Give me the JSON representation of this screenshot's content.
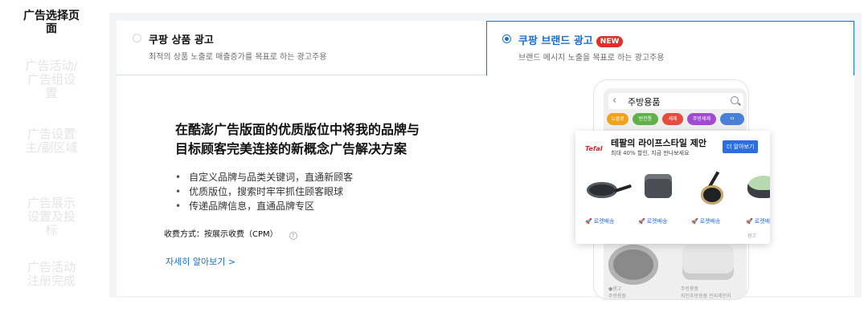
{
  "steps": [
    {
      "label": "广告选择页面",
      "active": true
    },
    {
      "label": "广告活动/广告组设置",
      "active": false
    },
    {
      "label": "广告设置主/副区域",
      "active": false
    },
    {
      "label": "广告展示设置及投标",
      "active": false
    },
    {
      "label": "广告活动注册完成",
      "active": false
    }
  ],
  "tabs": {
    "product": {
      "title": "쿠팡 상품 광고",
      "subtitle": "최적의 상품 노출로 매출증가를 목표로 하는 광고주용",
      "selected": false
    },
    "brand": {
      "title": "쿠팡 브랜드 광고",
      "badge": "NEW",
      "subtitle": "브랜드 메시지 노출을 목표로 하는 광고주용",
      "selected": true
    }
  },
  "content": {
    "headline_line1": "在酷澎广告版面的优质版位中将我的品牌与",
    "headline_line2": "目标顾客完美连接的新概念广告解决方案",
    "bullets": [
      "自定义品牌与品类关键词，直通新顾客",
      "优质版位，搜索时牢牢抓住顾客眼球",
      "传递品牌信息，直通品牌专区"
    ],
    "fee_text": "收费方式：按展示收费（CPM）",
    "help_icon": "?",
    "more_link": "자세히 알아보기 >"
  },
  "phone": {
    "back_icon": "‹",
    "search_text": "주방용품",
    "chips": [
      "뉴몰로",
      "반찬통",
      "세제",
      "주방세제",
      "ㅁ"
    ],
    "tiny1": "●광고",
    "tiny1b": "주방용품",
    "tiny2": "주방용품",
    "tiny2b": "지인추방용품 전지레인지"
  },
  "brand_card": {
    "logo": "Tefal",
    "title": "테팔의 라이프스타일 제안",
    "subtitle": "최대 40% 할인, 지금 만나보세요",
    "button": "더 알아보기",
    "delivery_label": "로켓배송",
    "extra_tag": "광고"
  },
  "colors": {
    "accent_blue": "#1a6fd4",
    "new_badge": "#e52d27",
    "panel_bg": "#f3f4f6"
  }
}
